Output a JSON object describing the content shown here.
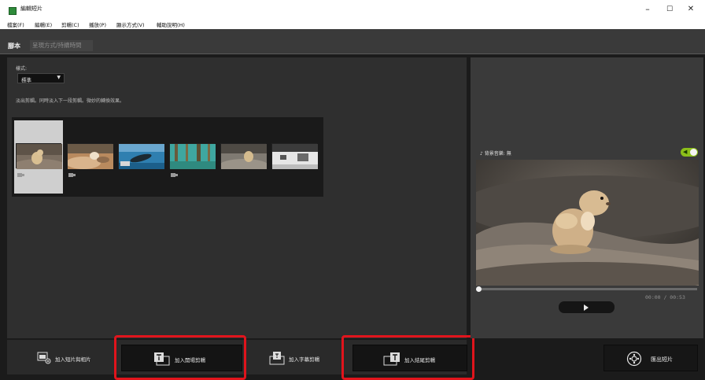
{
  "window": {
    "title": "編輯短片",
    "minimize": "–",
    "maximize": "☐",
    "close": "✕"
  },
  "menu": {
    "items": [
      "檔案(F)",
      "編輯(E)",
      "剪輯(C)",
      "播放(P)",
      "顯示方式(V)",
      "輔助說明(H)"
    ]
  },
  "tabs": {
    "script": "腳本",
    "duration": "呈現方式/持續時間"
  },
  "style_section": {
    "label": "樣式:",
    "selected": "標準",
    "description": "淡出剪輯。同時淡入下一段剪輯。微妙的轉換效果。"
  },
  "bottom_actions": {
    "add_clips_photos": "加入短片與相片",
    "add_opening": "加入開場剪輯",
    "add_caption": "加入字幕剪輯",
    "add_ending": "加入結尾剪輯"
  },
  "preview": {
    "bgm_label": "背景音樂: 無",
    "time": "00:00 / 00:53",
    "bgm_enabled": true
  },
  "export": {
    "label": "匯出短片"
  },
  "colors": {
    "highlight": "#e0141c",
    "toggle_on": "#8cbf1a"
  },
  "icons": {
    "music": "♪",
    "speaker": "◀"
  }
}
